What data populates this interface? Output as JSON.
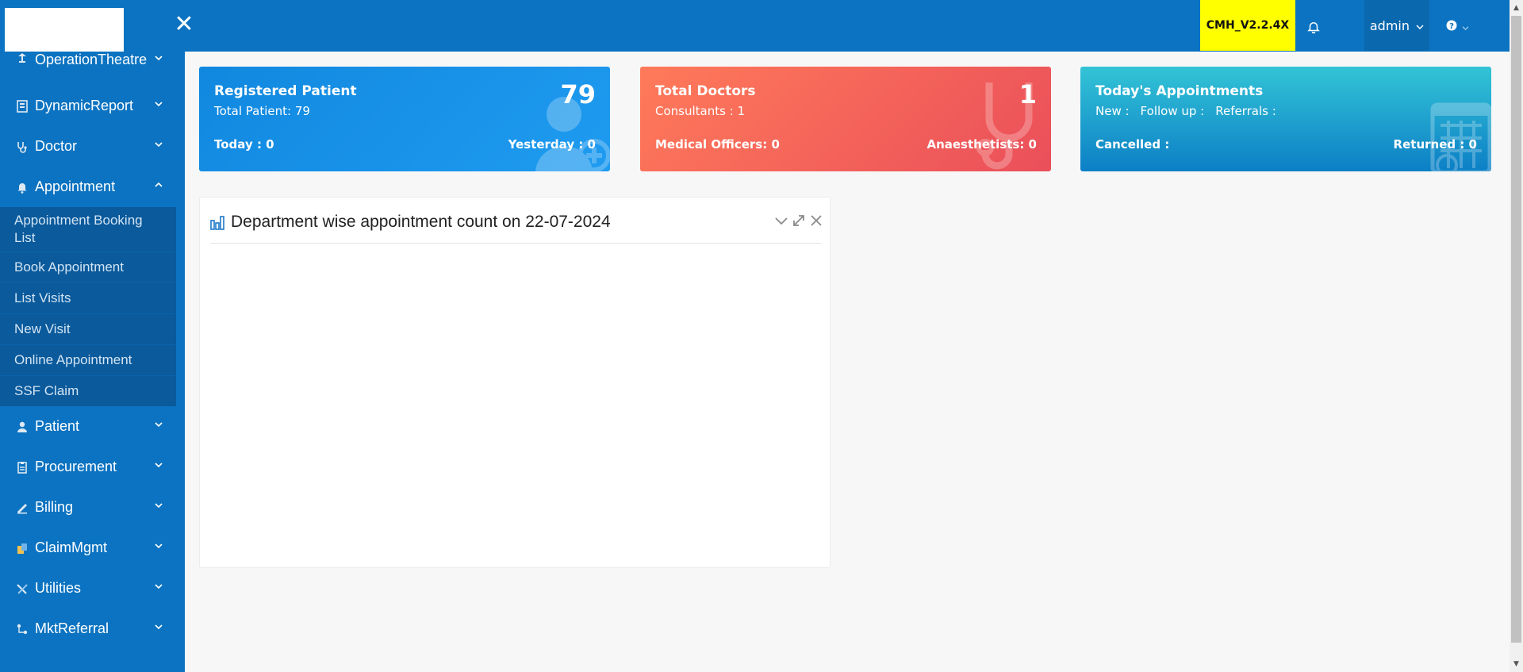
{
  "header": {
    "close_symbol": "✕",
    "version": "CMH_V2.2.4X",
    "user_label": "admin",
    "icons": {
      "bell": "bell-icon",
      "help": "help-circle-icon"
    }
  },
  "sidebar": {
    "items": [
      {
        "label": "OperationTheatre",
        "icon": "lamp-icon"
      },
      {
        "label": "DynamicReport",
        "icon": "report-icon"
      },
      {
        "label": "Doctor",
        "icon": "stethoscope-icon"
      },
      {
        "label": "Appointment",
        "icon": "bell-icon",
        "expanded": true
      },
      {
        "label": "Patient",
        "icon": "user-icon"
      },
      {
        "label": "Procurement",
        "icon": "clipboard-icon"
      },
      {
        "label": "Billing",
        "icon": "billing-icon"
      },
      {
        "label": "ClaimMgmt",
        "icon": "claim-icon"
      },
      {
        "label": "Utilities",
        "icon": "tools-icon"
      },
      {
        "label": "MktReferral",
        "icon": "referral-icon"
      }
    ],
    "appointment_submenu": [
      "Appointment Booking List",
      "Book Appointment",
      "List Visits",
      "New Visit",
      "Online Appointment",
      "SSF Claim"
    ]
  },
  "cards": {
    "registered": {
      "title": "Registered Patient",
      "line1": "Total Patient: 79",
      "count": "79",
      "bottom_left": "Today : 0",
      "bottom_right": "Yesterday : 0",
      "color": "#1b95ea"
    },
    "doctors": {
      "title": "Total Doctors",
      "line1": "Consultants : 1",
      "count": "1",
      "bottom_left": "Medical Officers: 0",
      "bottom_right": "Anaesthetists: 0",
      "color": "#f0605a"
    },
    "appointments": {
      "title": "Today's Appointments",
      "new": "New :",
      "followup": "Follow up :",
      "referrals": "Referrals :",
      "bottom_left": "Cancelled :",
      "bottom_right": "Returned : 0",
      "color": "#1aa3d0"
    }
  },
  "panel": {
    "title": "Department wise appointment count on 22-07-2024"
  },
  "colors": {
    "topbar": "#0b73c1",
    "sidebar": "#0b73c1",
    "submenu": "#0a5a9c",
    "version_badge": "#ffff00"
  }
}
